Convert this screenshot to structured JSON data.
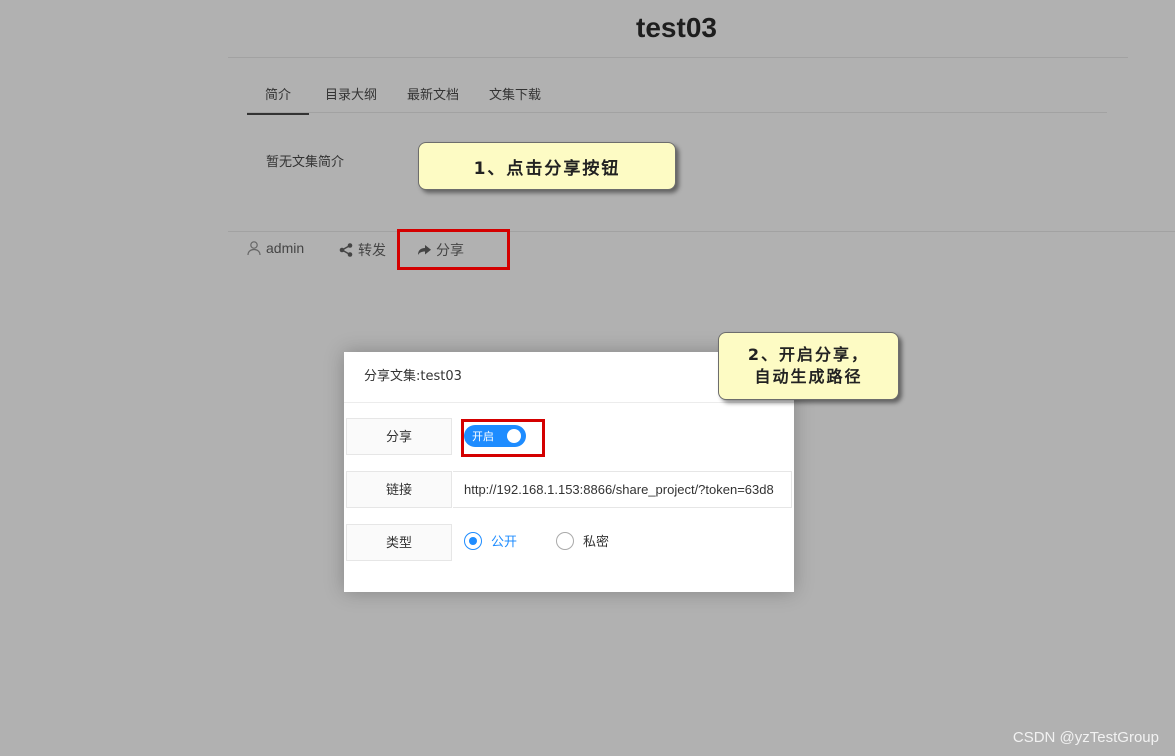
{
  "page": {
    "title": "test03"
  },
  "tabs": [
    {
      "label": "简介",
      "active": true
    },
    {
      "label": "目录大纲",
      "active": false
    },
    {
      "label": "最新文档",
      "active": false
    },
    {
      "label": "文集下载",
      "active": false
    }
  ],
  "intro": {
    "text": "暂无文集简介"
  },
  "meta": {
    "author": "admin",
    "forward_label": "转发",
    "share_label": "分享",
    "author_icon": "user-icon",
    "forward_icon": "share-nodes-icon",
    "share_icon": "share-arrow-icon"
  },
  "callouts": {
    "step1": "1、点击分享按钮",
    "step2": "2、开启分享，\n自动生成路径"
  },
  "modal": {
    "title": "分享文集:test03",
    "share_label": "分享",
    "share_switch_text": "开启",
    "share_enabled": true,
    "link_label": "链接",
    "link_value": "http://192.168.1.153:8866/share_project/?token=63d8",
    "type_label": "类型",
    "type_options": [
      {
        "label": "公开",
        "selected": true
      },
      {
        "label": "私密",
        "selected": false
      }
    ]
  },
  "watermark": "CSDN @yzTestGroup",
  "colors": {
    "overlay_background": "#b1b1b1",
    "accent": "#1e8cff",
    "highlight_box": "#d40000",
    "callout_background": "#fdfbc4"
  }
}
